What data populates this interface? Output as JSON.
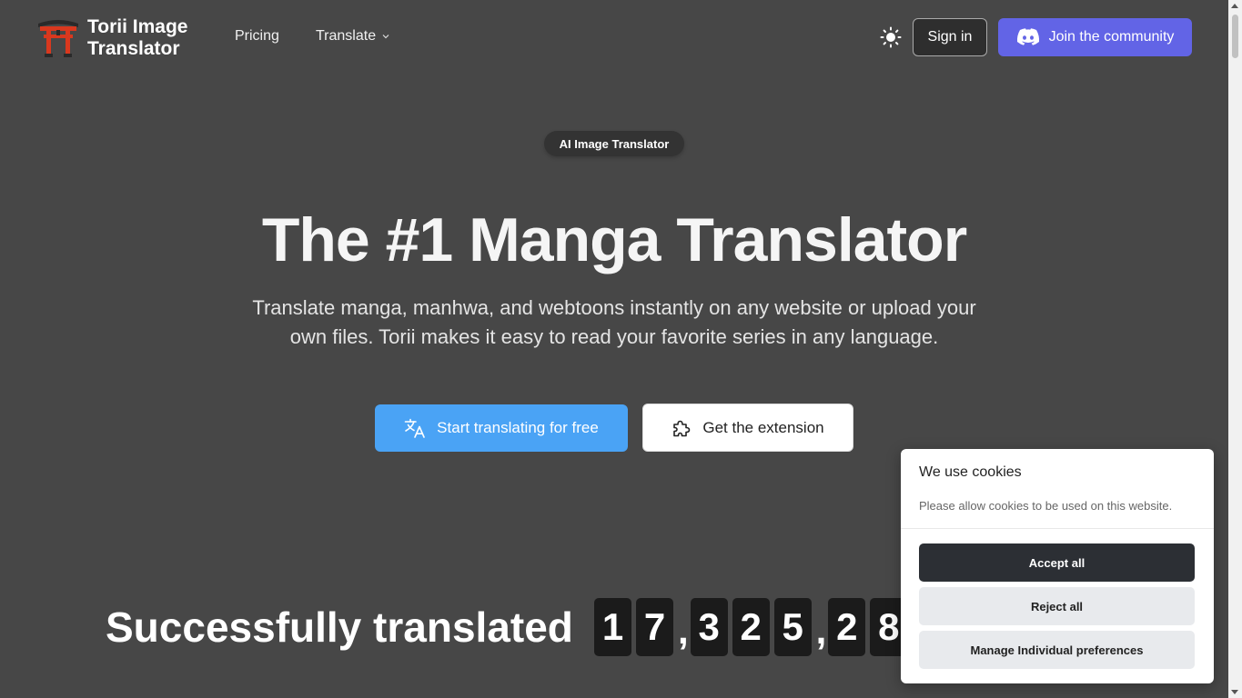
{
  "header": {
    "logo_line1": "Torii Image",
    "logo_line2": "Translator",
    "nav": {
      "pricing": "Pricing",
      "translate": "Translate"
    },
    "sign_in": "Sign in",
    "join": "Join the community"
  },
  "hero": {
    "badge": "AI Image Translator",
    "title": "The #1 Manga Translator",
    "subtitle_line1": "Translate manga, manhwa, and webtoons instantly on any website or upload your",
    "subtitle_line2": "own files. Torii makes it easy to read your favorite series in any language.",
    "cta_primary": "Start translating for free",
    "cta_secondary": "Get the extension"
  },
  "stats": {
    "label": "Successfully translated",
    "digits": [
      "1",
      "7",
      ",",
      "3",
      "2",
      "5",
      ",",
      "2",
      "8"
    ]
  },
  "cookies": {
    "title": "We use cookies",
    "text": "Please allow cookies to be used on this website.",
    "accept": "Accept all",
    "reject": "Reject all",
    "manage": "Manage Individual preferences"
  },
  "colors": {
    "background": "#474747",
    "discord": "#6264e6",
    "primary": "#4aa3f5",
    "torii_red": "#d9381e"
  }
}
